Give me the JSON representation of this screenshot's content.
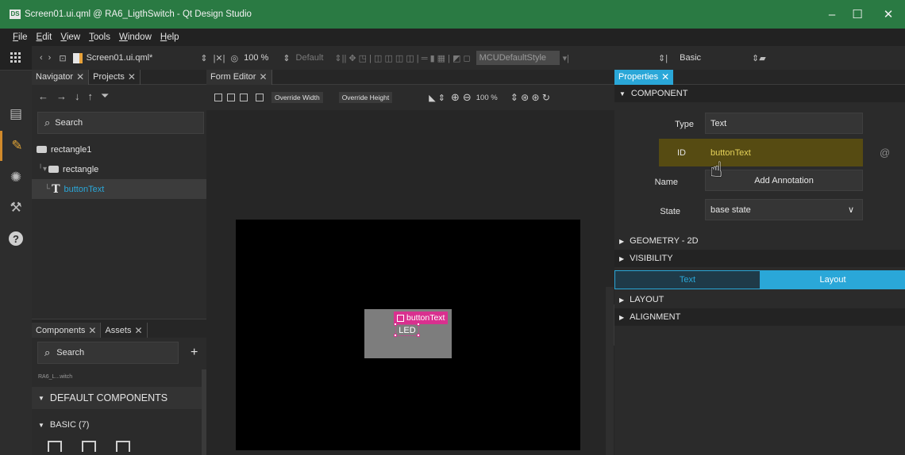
{
  "window": {
    "app_icon": "DS",
    "title": "Screen01.ui.qml @ RA6_LigthSwitch - Qt Design Studio",
    "minimize": "–",
    "maximize": "☐",
    "close": "✕"
  },
  "menu": [
    "File",
    "Edit",
    "View",
    "Tools",
    "Window",
    "Help"
  ],
  "toolbar": {
    "file": "Screen01.ui.qml*",
    "zoom": "100 %",
    "state": "Default",
    "style": "MCUDefaultStyle",
    "preset": "Basic"
  },
  "navigator": {
    "tabs": [
      "Navigator",
      "Projects"
    ],
    "search_placeholder": "Search",
    "tree": [
      {
        "label": "rectangle1"
      },
      {
        "label": "rectangle"
      },
      {
        "label": "buttonText"
      }
    ]
  },
  "components": {
    "tabs": [
      "Components",
      "Assets"
    ],
    "search_placeholder": "Search",
    "truncated_item": "RA6_L...witch",
    "sections": [
      "DEFAULT COMPONENTS",
      "BASIC (7)"
    ]
  },
  "form_editor": {
    "tab": "Form Editor",
    "override_width": "Override Width",
    "override_height": "Override Height",
    "zoom": "100 %",
    "selected_label": "buttonText",
    "selected_text": "LED"
  },
  "properties": {
    "tab": "Properties",
    "section_component": "COMPONENT",
    "type_label": "Type",
    "type_value": "Text",
    "id_label": "ID",
    "id_value": "buttonText",
    "name_label": "Name",
    "add_annotation": "Add Annotation",
    "state_label": "State",
    "state_value": "base state",
    "geometry": "GEOMETRY - 2D",
    "visibility": "VISIBILITY",
    "subtab_text": "Text",
    "subtab_layout": "Layout",
    "layout": "LAYOUT",
    "alignment": "ALIGNMENT"
  },
  "colors": {
    "title_bar": "#2a7a43",
    "accent": "#2aa7d8",
    "selection": "#d9308f",
    "edit_mode": "#e0a437",
    "id_highlight": "#564b12"
  }
}
